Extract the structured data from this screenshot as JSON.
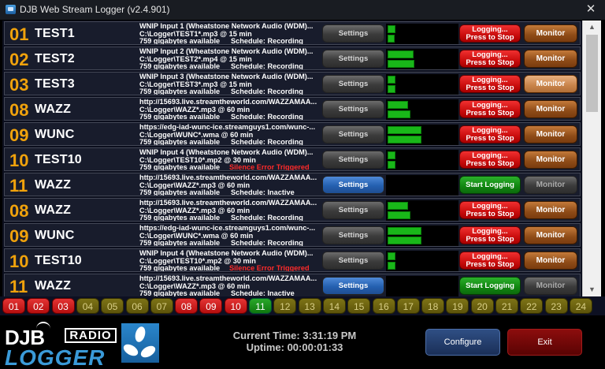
{
  "window": {
    "title": "DJB Web Stream Logger (v2.4.901)",
    "close_label": "✕"
  },
  "streams": [
    {
      "num": "01",
      "name": "TEST1",
      "line1": "WNIP Input 1 (Wheatstone Network Audio (WDM)...",
      "line2": "C:\\Logger\\TEST1*.mp3 @ 15 min",
      "line3": "759 gigabytes available",
      "status": "Schedule: Recording",
      "status_type": "normal",
      "settings_label": "Settings",
      "settings_active": false,
      "logging_label": "Logging... Press to Stop",
      "logging": true,
      "monitor_label": "Monitor",
      "monitor_state": "on",
      "meter": [
        0.12,
        0.1
      ]
    },
    {
      "num": "02",
      "name": "TEST2",
      "line1": "WNIP Input 2 (Wheatstone Network Audio (WDM)...",
      "line2": "C:\\Logger\\TEST2*.mp4 @ 15 min",
      "line3": "759 gigabytes available",
      "status": "Schedule: Recording",
      "status_type": "normal",
      "settings_label": "Settings",
      "settings_active": false,
      "logging_label": "Logging... Press to Stop",
      "logging": true,
      "monitor_label": "Monitor",
      "monitor_state": "on",
      "meter": [
        0.38,
        0.4
      ]
    },
    {
      "num": "03",
      "name": "TEST3",
      "line1": "WNIP Input 3 (Wheatstone Network Audio (WDM)...",
      "line2": "C:\\Logger\\TEST3*.mp3 @ 15 min",
      "line3": "759 gigabytes available",
      "status": "Schedule: Recording",
      "status_type": "normal",
      "settings_label": "Settings",
      "settings_active": false,
      "logging_label": "Logging... Press to Stop",
      "logging": true,
      "monitor_label": "Monitor",
      "monitor_state": "hot",
      "meter": [
        0.12,
        0.12
      ]
    },
    {
      "num": "08",
      "name": "WAZZ",
      "line1": "http://15693.live.streamtheworld.com/WAZZAMAA...",
      "line2": "C:\\Logger\\WAZZ*.mp3 @ 60 min",
      "line3": "759 gigabytes available",
      "status": "Schedule: Recording",
      "status_type": "normal",
      "settings_label": "Settings",
      "settings_active": false,
      "logging_label": "Logging... Press to Stop",
      "logging": true,
      "monitor_label": "Monitor",
      "monitor_state": "on",
      "meter": [
        0.3,
        0.34
      ]
    },
    {
      "num": "09",
      "name": "WUNC",
      "line1": "https://edg-iad-wunc-ice.streamguys1.com/wunc-...",
      "line2": "C:\\Logger\\WUNC*.wma @ 60 min",
      "line3": "759 gigabytes available",
      "status": "Schedule: Recording",
      "status_type": "normal",
      "settings_label": "Settings",
      "settings_active": false,
      "logging_label": "Logging... Press to Stop",
      "logging": true,
      "monitor_label": "Monitor",
      "monitor_state": "on",
      "meter": [
        0.5,
        0.5
      ]
    },
    {
      "num": "10",
      "name": "TEST10",
      "line1": "WNIP Input 4 (Wheatstone Network Audio (WDM)...",
      "line2": "C:\\Logger\\TEST10*.mp2 @ 30 min",
      "line3": "759 gigabytes available",
      "status": "Silence Error Triggered",
      "status_type": "error",
      "settings_label": "Settings",
      "settings_active": false,
      "logging_label": "Logging... Press to Stop",
      "logging": true,
      "monitor_label": "Monitor",
      "monitor_state": "on",
      "meter": [
        0.12,
        0.12
      ]
    },
    {
      "num": "11",
      "name": "WAZZ",
      "line1": "http://15693.live.streamtheworld.com/WAZZAMAA...",
      "line2": "C:\\Logger\\WAZZ*.mp3 @ 60 min",
      "line3": "759 gigabytes available",
      "status": "Schedule: Inactive",
      "status_type": "normal",
      "settings_label": "Settings",
      "settings_active": true,
      "logging_label": "Start Logging",
      "logging": false,
      "monitor_label": "Monitor",
      "monitor_state": "off",
      "meter": [
        0,
        0
      ]
    },
    {
      "num": "08",
      "name": "WAZZ",
      "line1": "http://15693.live.streamtheworld.com/WAZZAMAA...",
      "line2": "C:\\Logger\\WAZZ*.mp3 @ 60 min",
      "line3": "759 gigabytes available",
      "status": "Schedule: Recording",
      "status_type": "normal",
      "settings_label": "Settings",
      "settings_active": false,
      "logging_label": "Logging... Press to Stop",
      "logging": true,
      "monitor_label": "Monitor",
      "monitor_state": "on",
      "meter": [
        0.3,
        0.34
      ]
    },
    {
      "num": "09",
      "name": "WUNC",
      "line1": "https://edg-iad-wunc-ice.streamguys1.com/wunc-...",
      "line2": "C:\\Logger\\WUNC*.wma @ 60 min",
      "line3": "759 gigabytes available",
      "status": "Schedule: Recording",
      "status_type": "normal",
      "settings_label": "Settings",
      "settings_active": false,
      "logging_label": "Logging... Press to Stop",
      "logging": true,
      "monitor_label": "Monitor",
      "monitor_state": "on",
      "meter": [
        0.5,
        0.5
      ]
    },
    {
      "num": "10",
      "name": "TEST10",
      "line1": "WNIP Input 4 (Wheatstone Network Audio (WDM)...",
      "line2": "C:\\Logger\\TEST10*.mp2 @ 30 min",
      "line3": "759 gigabytes available",
      "status": "Silence Error Triggered",
      "status_type": "error",
      "settings_label": "Settings",
      "settings_active": false,
      "logging_label": "Logging... Press to Stop",
      "logging": true,
      "monitor_label": "Monitor",
      "monitor_state": "on",
      "meter": [
        0.12,
        0.12
      ]
    },
    {
      "num": "11",
      "name": "WAZZ",
      "line1": "http://15693.live.streamtheworld.com/WAZZAMAA...",
      "line2": "C:\\Logger\\WAZZ*.mp3 @ 60 min",
      "line3": "759 gigabytes available",
      "status": "Schedule: Inactive",
      "status_type": "normal",
      "settings_label": "Settings",
      "settings_active": true,
      "logging_label": "Start Logging",
      "logging": false,
      "monitor_label": "Monitor",
      "monitor_state": "off",
      "meter": [
        0,
        0
      ]
    }
  ],
  "slots": [
    {
      "label": "01",
      "state": "red"
    },
    {
      "label": "02",
      "state": "red"
    },
    {
      "label": "03",
      "state": "red"
    },
    {
      "label": "04",
      "state": "olive"
    },
    {
      "label": "05",
      "state": "olive"
    },
    {
      "label": "06",
      "state": "olive"
    },
    {
      "label": "07",
      "state": "olive"
    },
    {
      "label": "08",
      "state": "red"
    },
    {
      "label": "09",
      "state": "red"
    },
    {
      "label": "10",
      "state": "red"
    },
    {
      "label": "11",
      "state": "green"
    },
    {
      "label": "12",
      "state": "olive"
    },
    {
      "label": "13",
      "state": "olive"
    },
    {
      "label": "14",
      "state": "olive"
    },
    {
      "label": "15",
      "state": "olive"
    },
    {
      "label": "16",
      "state": "olive"
    },
    {
      "label": "17",
      "state": "olive"
    },
    {
      "label": "18",
      "state": "olive"
    },
    {
      "label": "19",
      "state": "olive"
    },
    {
      "label": "20",
      "state": "olive"
    },
    {
      "label": "21",
      "state": "olive"
    },
    {
      "label": "22",
      "state": "olive"
    },
    {
      "label": "23",
      "state": "olive"
    },
    {
      "label": "24",
      "state": "olive"
    }
  ],
  "footer": {
    "logo_djb": "DJB",
    "logo_radio": "RADIO",
    "logo_logger": "LOGGER",
    "current_time_label": "Current Time: 3:31:19 PM",
    "uptime_label": "Uptime: 00:00:01:33",
    "configure_label": "Configure",
    "exit_label": "Exit"
  },
  "colors": {
    "accent_number": "#f0a20c",
    "logging_red": "#e02020",
    "start_green": "#149414",
    "monitor_brown": "#8e4b17",
    "meter_green": "#19b719"
  }
}
